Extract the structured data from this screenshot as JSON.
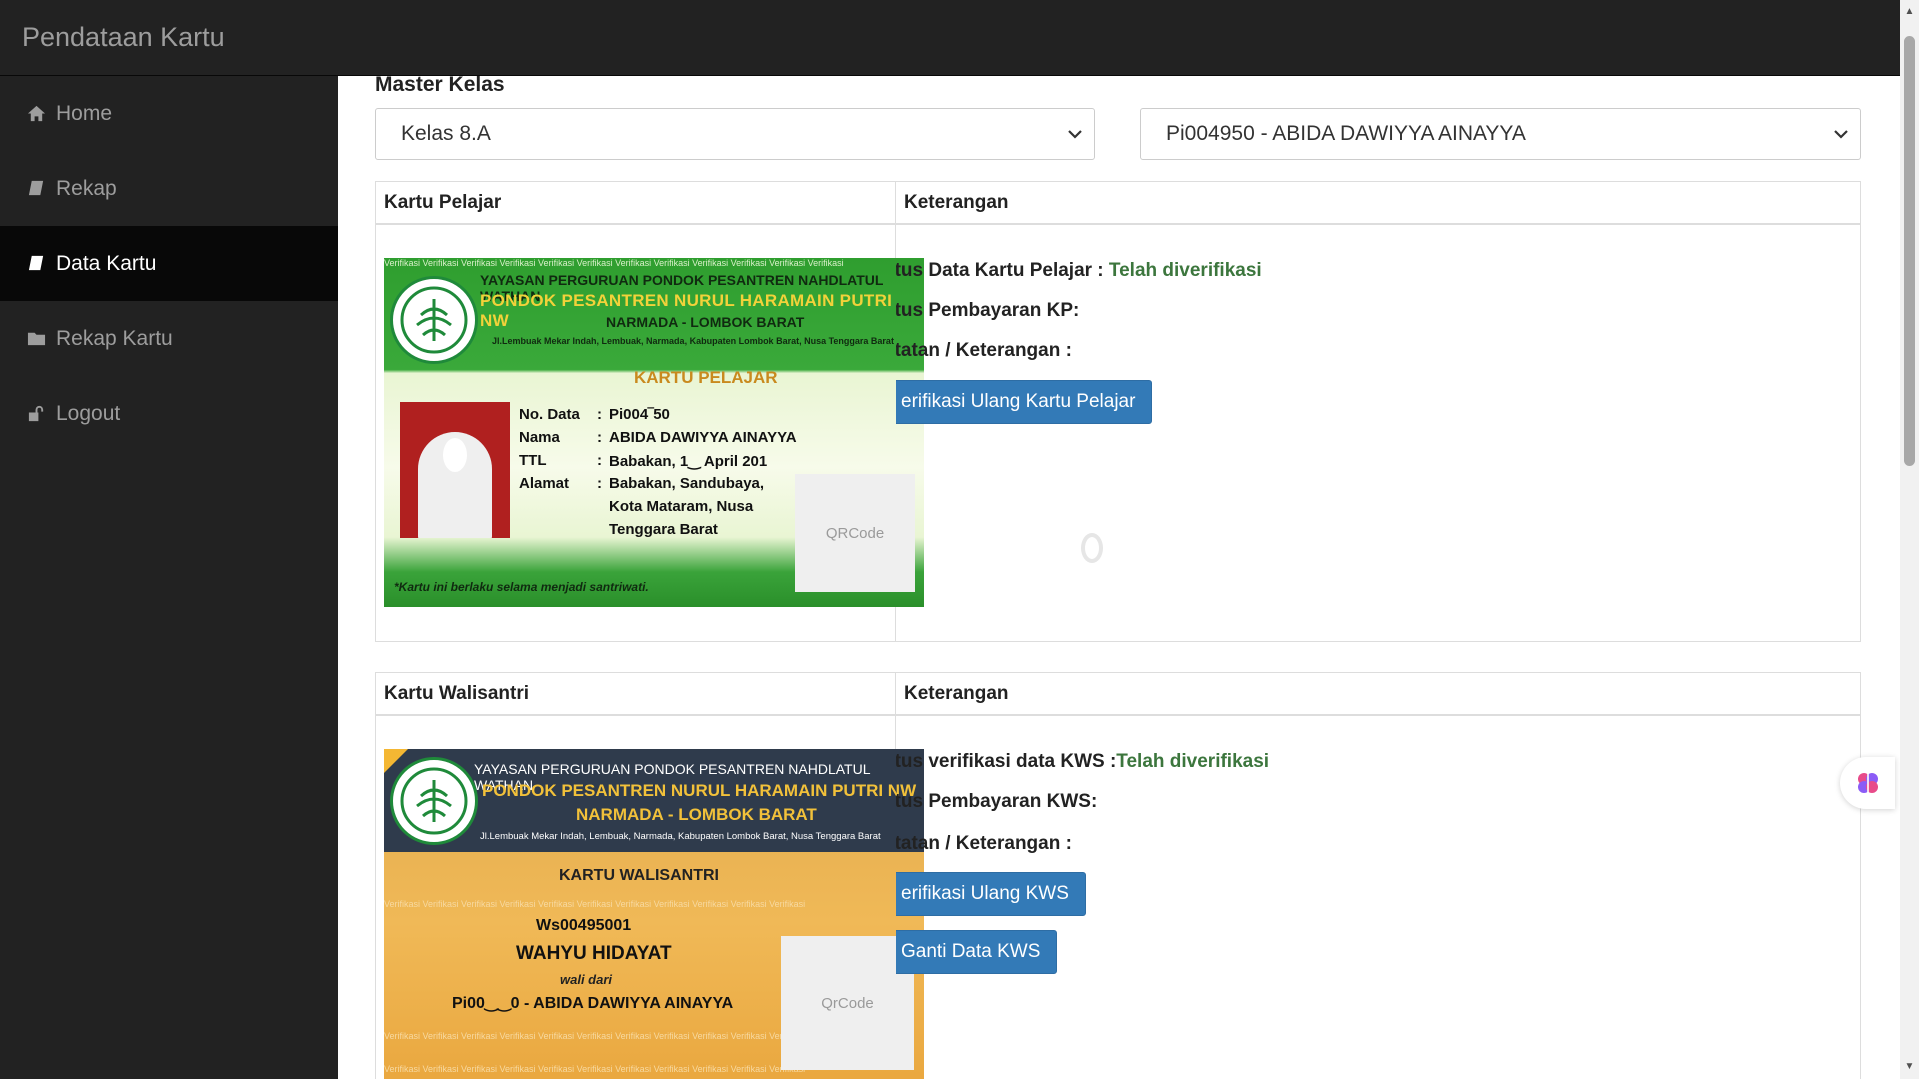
{
  "brand": "Pendataan Kartu",
  "sidebar": {
    "items": [
      {
        "label": "Home",
        "icon": "home-icon"
      },
      {
        "label": "Rekap",
        "icon": "book-icon"
      },
      {
        "label": "Data Kartu",
        "icon": "book-icon",
        "active": true
      },
      {
        "label": "Rekap Kartu",
        "icon": "folder-icon"
      },
      {
        "label": "Logout",
        "icon": "unlock-icon"
      }
    ]
  },
  "main": {
    "master_label": "Master Kelas",
    "kelas_select": "Kelas 8.A",
    "santri_select": "Pi004950 - ABIDA DAWIYYA AINAYYA",
    "kp_table": {
      "col1": "Kartu Pelajar",
      "col2": "Keterangan",
      "status_label": "atus Data Kartu Pelajar : ",
      "status_value": "Telah diverifikasi",
      "payment_label": "atus Pembayaran KP:",
      "note_label": "atatan / Keterangan :",
      "verify_button": "erifikasi Ulang Kartu Pelajar"
    },
    "kws_table": {
      "col1": "Kartu Walisantri",
      "col2": "Keterangan",
      "status_label": "atus verifikasi data KWS :",
      "status_value": "Telah diverifikasi",
      "payment_label": "atus Pembayaran KWS:",
      "note_label": "atatan / Keterangan :",
      "verify_button": "erifikasi Ulang KWS",
      "change_button": "Ganti Data KWS"
    }
  },
  "kp_card": {
    "watermark": "Verifikasi Verifikasi Verifikasi Verifikasi Verifikasi Verifikasi Verifikasi Verifikasi Verifikasi Verifikasi Verifikasi Verifikasi",
    "header1": "YAYASAN PERGURUAN PONDOK PESANTREN NAHDLATUL WATHAN",
    "header2": "PONDOK PESANTREN NURUL HARAMAIN PUTRI NW",
    "header3": "NARMADA - LOMBOK BARAT",
    "header4": "Jl.Lembuak Mekar Indah, Lembuak, Narmada, Kabupaten Lombok Barat, Nusa Tenggara Barat",
    "title": "KARTU PELAJAR",
    "rows": [
      {
        "k": "No. Data",
        "v": "Pi004‾50"
      },
      {
        "k": "Nama",
        "v": "ABIDA DAWIYYA AINAYYA"
      },
      {
        "k": "TTL",
        "v": "Babakan, 1‿ April 201"
      },
      {
        "k": "Alamat",
        "v": "Babakan, Sandubaya,"
      },
      {
        "k": "",
        "v": "Kota Mataram, Nusa"
      },
      {
        "k": "",
        "v": "Tenggara Barat"
      }
    ],
    "qr": "QRCode",
    "note": "*Kartu ini berlaku selama menjadi santriwati."
  },
  "kws_card": {
    "header1": "YAYASAN PERGURUAN PONDOK PESANTREN NAHDLATUL WATHAN",
    "header2": "PONDOK PESANTREN NURUL HARAMAIN PUTRI NW",
    "header3": "NARMADA - LOMBOK BARAT",
    "header4": "Jl.Lembuak Mekar Indah, Lembuak, Narmada, Kabupaten Lombok Barat, Nusa Tenggara Barat",
    "title": "KARTU WALISANTRI",
    "watermark": "Verifikasi Verifikasi Verifikasi Verifikasi Verifikasi Verifikasi Verifikasi Verifikasi Verifikasi Verifikasi Verifikasi",
    "id": "Ws00495001",
    "name": "WAHYU HIDAYAT",
    "wali": "wali dari",
    "santri": "Pi00‿‿0 - ABIDA DAWIYYA AINAYYA",
    "qr": "QrCode"
  },
  "colors": {
    "navbar": "#222222",
    "active": "#080808",
    "primary": "#337ab7",
    "success": "#3c763d"
  }
}
